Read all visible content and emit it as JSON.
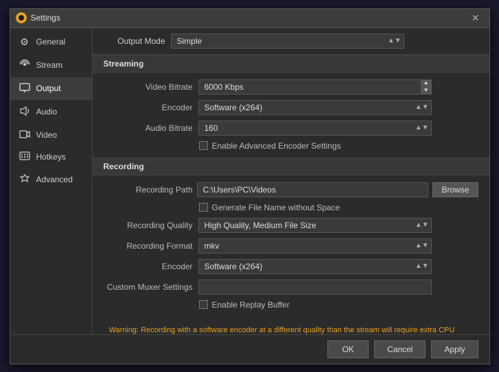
{
  "window": {
    "title": "Settings",
    "close_label": "✕"
  },
  "sidebar": {
    "items": [
      {
        "id": "general",
        "label": "General",
        "icon": "⚙"
      },
      {
        "id": "stream",
        "label": "Stream",
        "icon": "📡"
      },
      {
        "id": "output",
        "label": "Output",
        "icon": "🖥"
      },
      {
        "id": "audio",
        "label": "Audio",
        "icon": "🔊"
      },
      {
        "id": "video",
        "label": "Video",
        "icon": "📺"
      },
      {
        "id": "hotkeys",
        "label": "Hotkeys",
        "icon": "⌨"
      },
      {
        "id": "advanced",
        "label": "Advanced",
        "icon": "✱"
      }
    ]
  },
  "main": {
    "output_mode_label": "Output Mode",
    "output_mode_value": "Simple",
    "streaming_section": "Streaming",
    "video_bitrate_label": "Video Bitrate",
    "video_bitrate_value": "6000 Kbps",
    "encoder_label": "Encoder",
    "encoder_value": "Software (x264)",
    "audio_bitrate_label": "Audio Bitrate",
    "audio_bitrate_value": "160",
    "advanced_encoder_checkbox": "Enable Advanced Encoder Settings",
    "recording_section": "Recording",
    "recording_path_label": "Recording Path",
    "recording_path_value": "C:\\Users\\PC\\Videos",
    "browse_label": "Browse",
    "generate_filename_checkbox": "Generate File Name without Space",
    "recording_quality_label": "Recording Quality",
    "recording_quality_value": "High Quality, Medium File Size",
    "recording_format_label": "Recording Format",
    "recording_format_value": "mkv",
    "rec_encoder_label": "Encoder",
    "rec_encoder_value": "Software (x264)",
    "custom_muxer_label": "Custom Muxer Settings",
    "custom_muxer_value": "",
    "replay_buffer_checkbox": "Enable Replay Buffer",
    "warning_text": "Warning: Recording with a software encoder at a different quality than the stream will require extra CPU usage if you stream and record at the same time.",
    "ok_label": "OK",
    "cancel_label": "Cancel",
    "apply_label": "Apply"
  }
}
